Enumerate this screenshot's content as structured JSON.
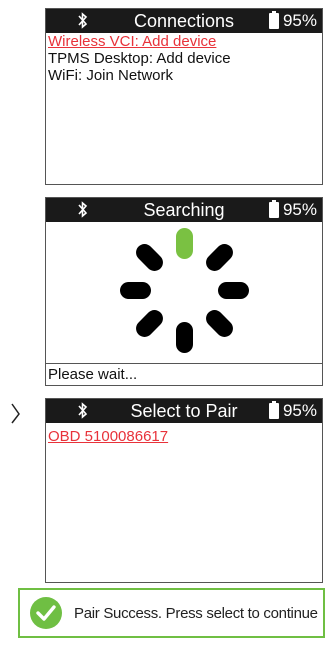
{
  "colors": {
    "accent_red": "#e8323a",
    "success_green": "#6fbf43",
    "titlebar": "#1a1a1a"
  },
  "screens": [
    {
      "title": "Connections",
      "battery": "95%",
      "items": [
        {
          "label": "Wireless VCI: Add device",
          "highlighted": true
        },
        {
          "label": "TPMS Desktop: Add device",
          "highlighted": false
        },
        {
          "label": "WiFi: Join Network",
          "highlighted": false
        }
      ]
    },
    {
      "title": "Searching",
      "battery": "95%",
      "footer": "Please wait...",
      "spinner": "loading-spinner"
    },
    {
      "title": "Select to Pair",
      "battery": "95%",
      "items": [
        {
          "label": "OBD 5100086617",
          "highlighted": true
        }
      ]
    }
  ],
  "notification": {
    "text": "Pair Success. Press select to continue",
    "icon": "check-circle-icon"
  }
}
